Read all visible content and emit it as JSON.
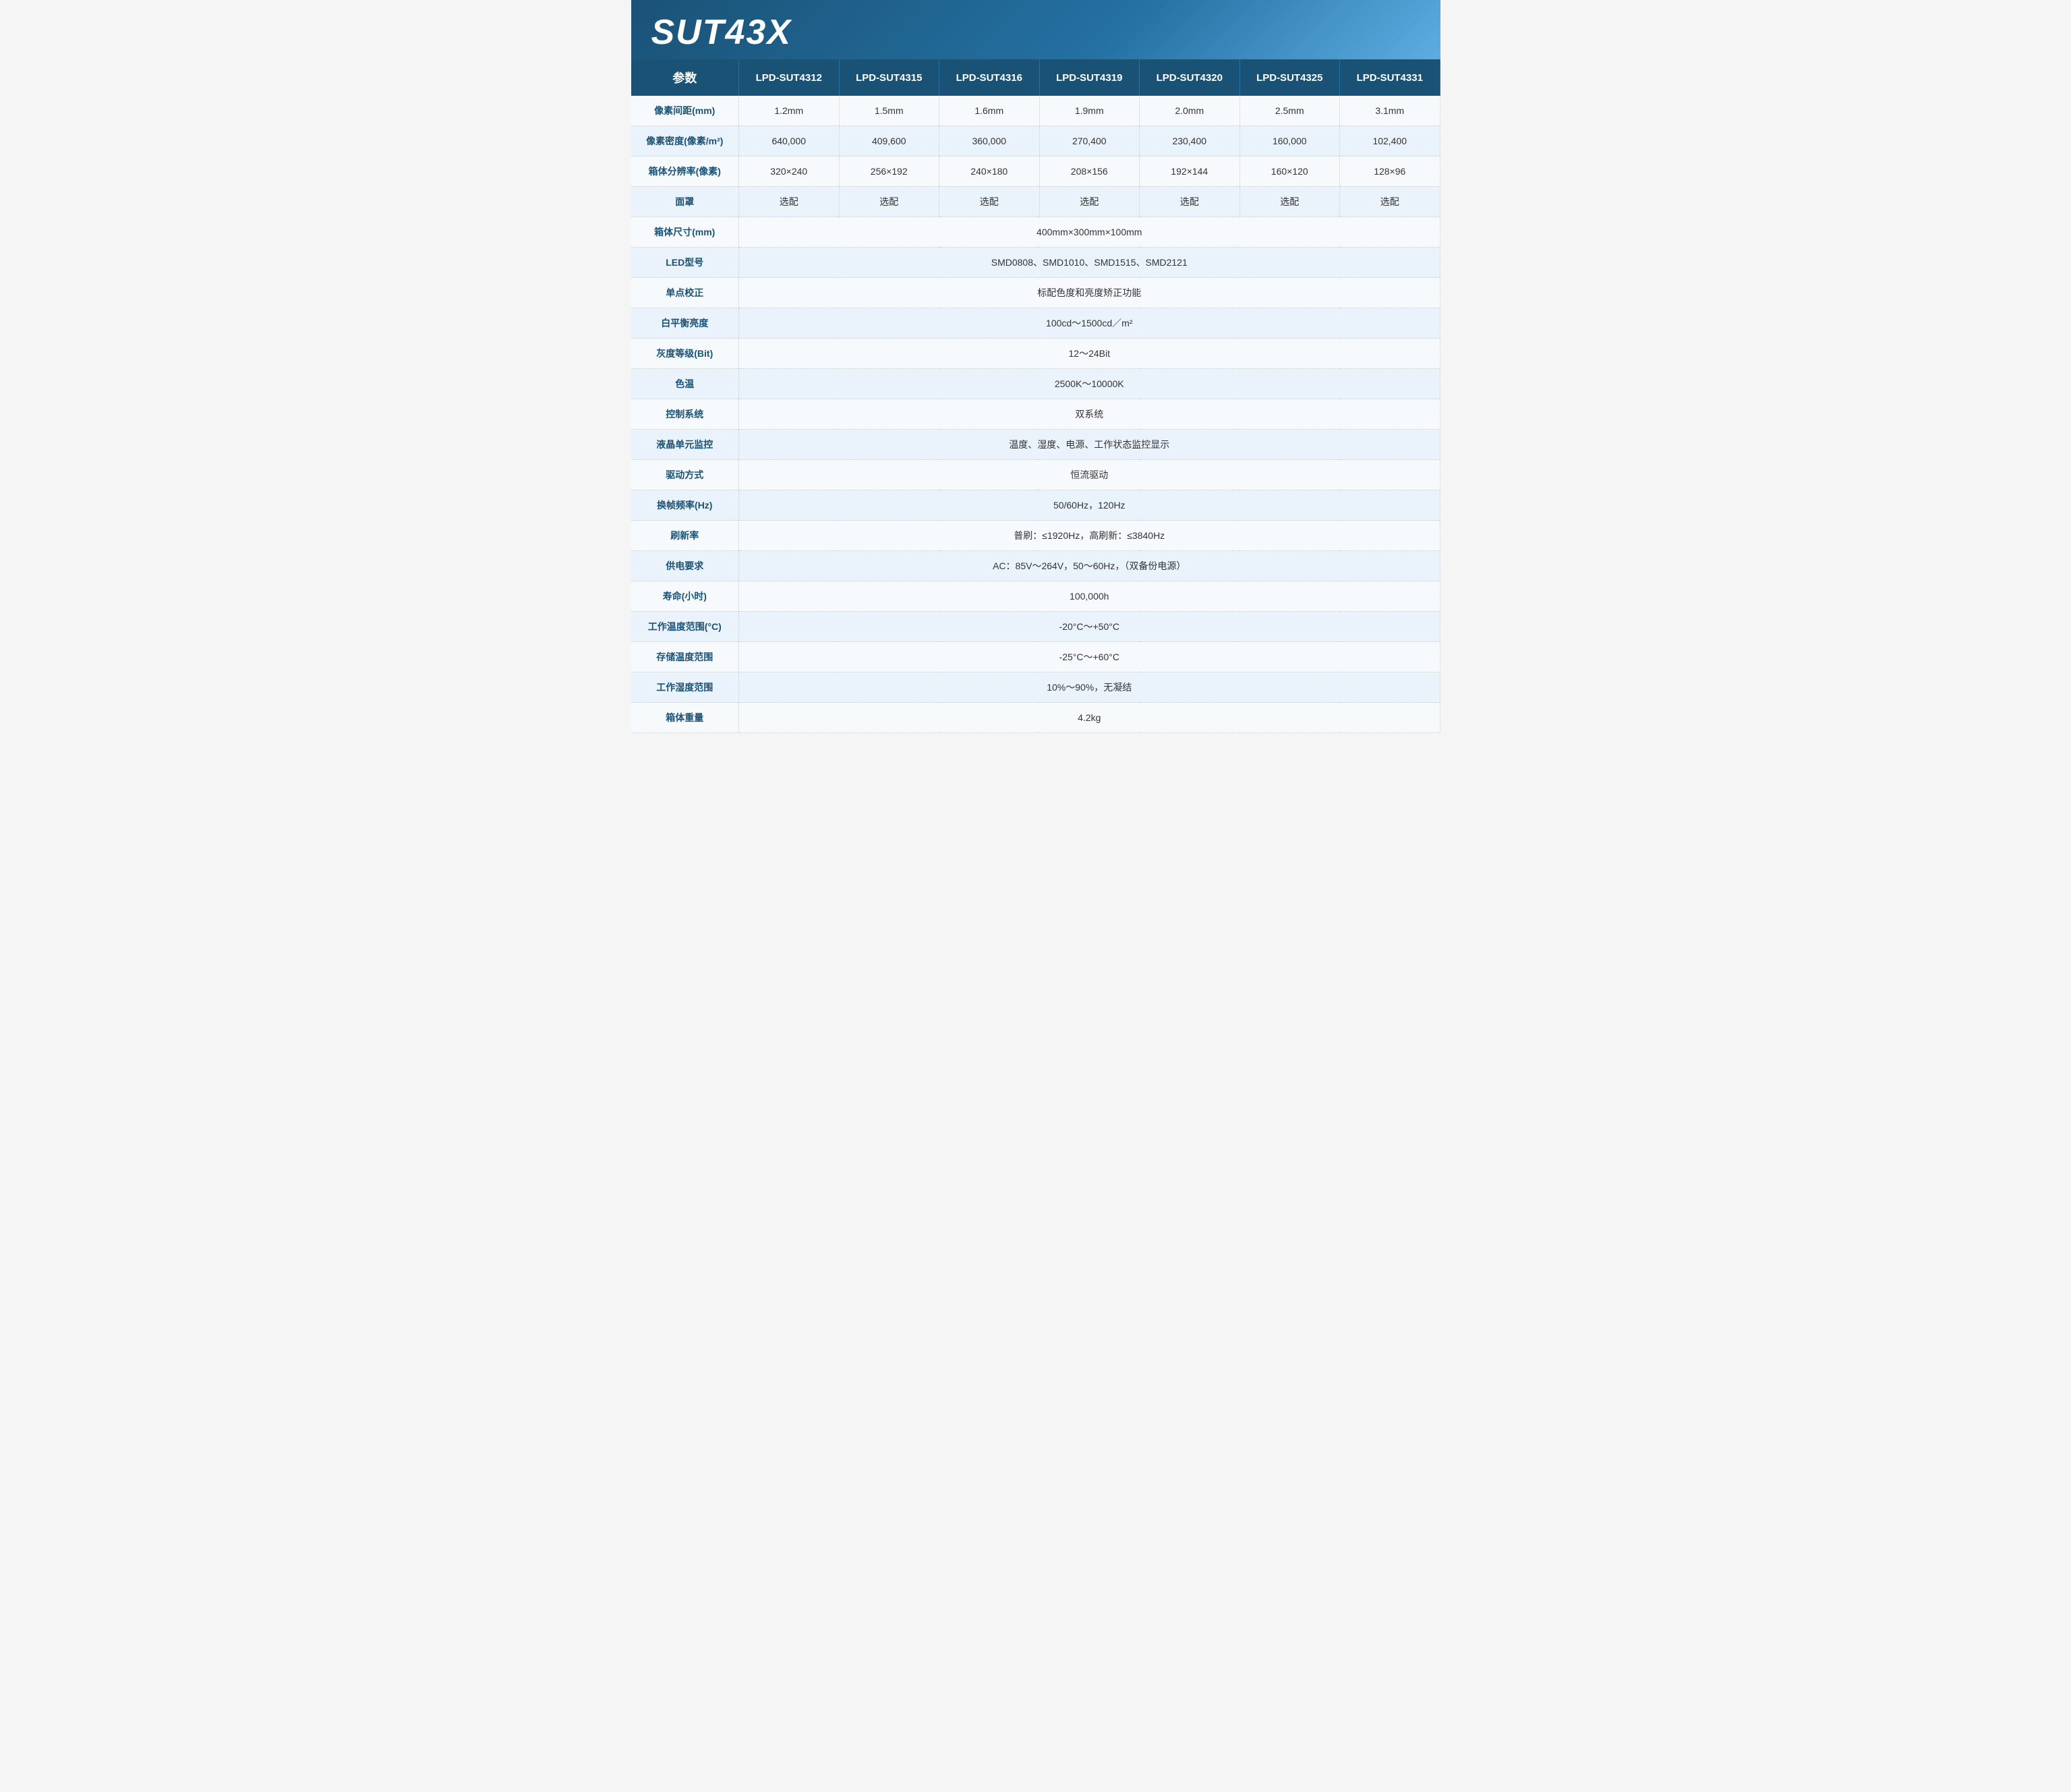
{
  "header": {
    "title": "SUT43X"
  },
  "table": {
    "col_header_param": "参数",
    "columns": [
      "LPD-SUT4312",
      "LPD-SUT4315",
      "LPD-SUT4316",
      "LPD-SUT4319",
      "LPD-SUT4320",
      "LPD-SUT4325",
      "LPD-SUT4331"
    ],
    "rows": [
      {
        "label": "像素间距(mm)",
        "values": [
          "1.2mm",
          "1.5mm",
          "1.6mm",
          "1.9mm",
          "2.0mm",
          "2.5mm",
          "3.1mm"
        ],
        "span": false
      },
      {
        "label": "像素密度(像素/m²)",
        "values": [
          "640,000",
          "409,600",
          "360,000",
          "270,400",
          "230,400",
          "160,000",
          "102,400"
        ],
        "span": false
      },
      {
        "label": "箱体分辨率(像素)",
        "values": [
          "320×240",
          "256×192",
          "240×180",
          "208×156",
          "192×144",
          "160×120",
          "128×96"
        ],
        "span": false
      },
      {
        "label": "面罩",
        "values": [
          "选配",
          "选配",
          "选配",
          "选配",
          "选配",
          "选配",
          "选配"
        ],
        "span": false
      },
      {
        "label": "箱体尺寸(mm)",
        "span": true,
        "spanValue": "400mm×300mm×100mm"
      },
      {
        "label": "LED型号",
        "span": true,
        "spanValue": "SMD0808、SMD1010、SMD1515、SMD2121"
      },
      {
        "label": "单点校正",
        "span": true,
        "spanValue": "标配色度和亮度矫正功能"
      },
      {
        "label": "白平衡亮度",
        "span": true,
        "spanValue": "100cd～1500cd／m²"
      },
      {
        "label": "灰度等级(Bit)",
        "span": true,
        "spanValue": "12～24Bit"
      },
      {
        "label": "色温",
        "span": true,
        "spanValue": "2500K～10000K"
      },
      {
        "label": "控制系统",
        "span": true,
        "spanValue": "双系统"
      },
      {
        "label": "液晶单元监控",
        "span": true,
        "spanValue": "温度、湿度、电源、工作状态监控显示"
      },
      {
        "label": "驱动方式",
        "span": true,
        "spanValue": "恒流驱动"
      },
      {
        "label": "换帧频率(Hz)",
        "span": true,
        "spanValue": "50/60Hz，120Hz"
      },
      {
        "label": "刷新率",
        "span": true,
        "spanValue": "普刷：≤1920Hz，高刷新：≤3840Hz"
      },
      {
        "label": "供电要求",
        "span": true,
        "spanValue": "AC：85V～264V，50～60Hz，（双备份电源）"
      },
      {
        "label": "寿命(小时)",
        "span": true,
        "spanValue": "100,000h"
      },
      {
        "label": "工作温度范围(°C)",
        "span": true,
        "spanValue": "-20°C～+50°C"
      },
      {
        "label": "存储温度范围",
        "span": true,
        "spanValue": "-25°C～+60°C"
      },
      {
        "label": "工作湿度范围",
        "span": true,
        "spanValue": "10%～90%，无凝结"
      },
      {
        "label": "箱体重量",
        "span": true,
        "spanValue": "4.2kg"
      }
    ]
  }
}
